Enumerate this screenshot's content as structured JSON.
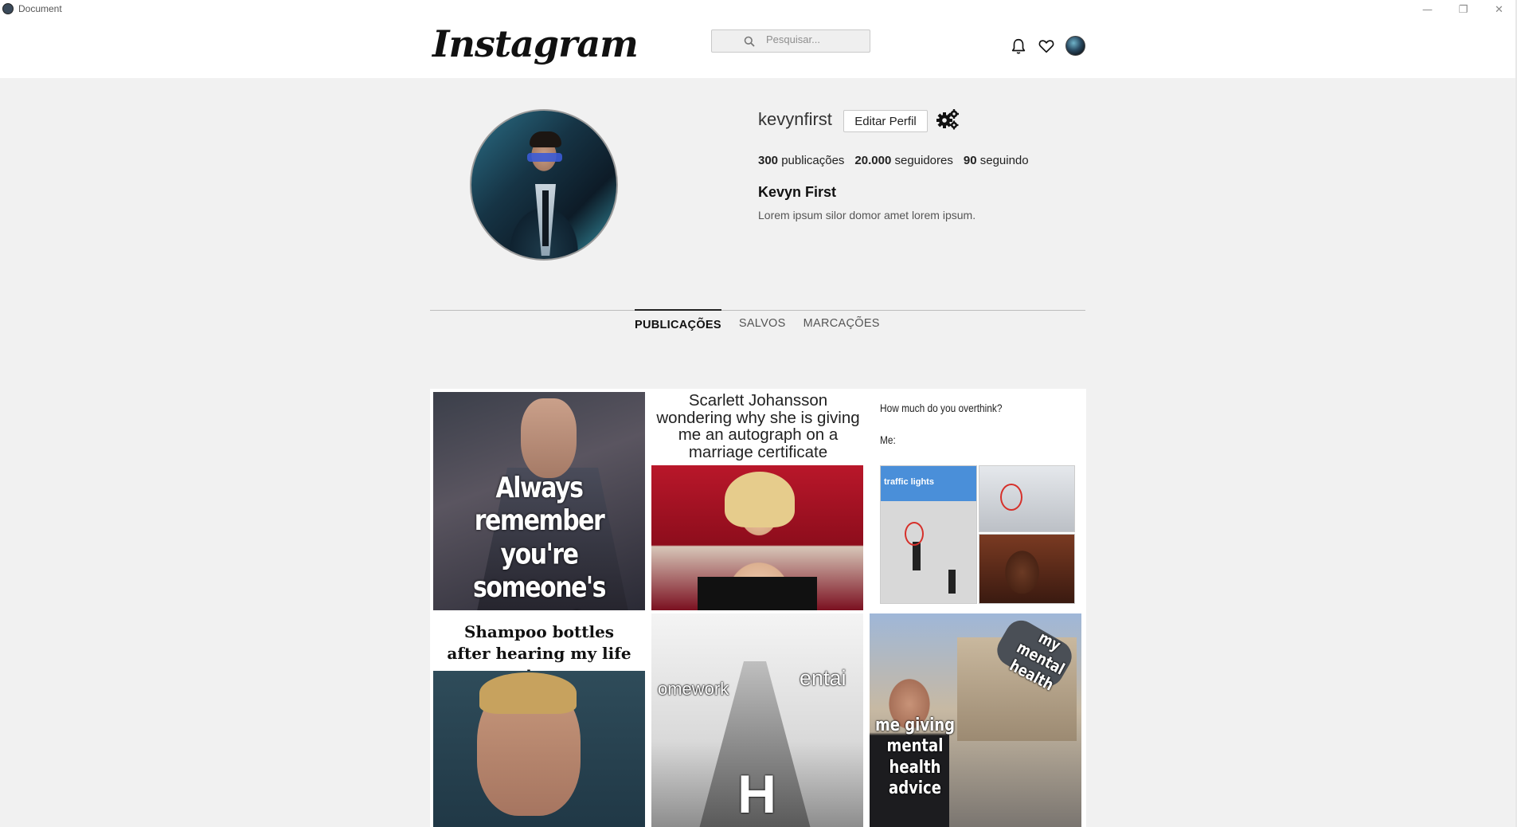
{
  "window": {
    "title": "Document",
    "minimize": "—",
    "restore": "❐",
    "close": "✕"
  },
  "nav": {
    "logo": "Instagram",
    "search_placeholder": "Pesquisar..."
  },
  "profile": {
    "username": "kevynfirst",
    "edit_label": "Editar Perfil",
    "stats": [
      {
        "count": "300",
        "label": "publicações"
      },
      {
        "count": "20.000",
        "label": "seguidores"
      },
      {
        "count": "90",
        "label": "seguindo"
      }
    ],
    "full_name": "Kevyn First",
    "bio": "Lorem ipsum silor domor amet lorem ipsum."
  },
  "tabs": [
    "PUBLICAÇÕES",
    "SALVOS",
    "MARCAÇÕES"
  ],
  "posts": {
    "p1": "Always remember you're someone's reason to smile Because you're a joke",
    "p2": "Scarlett Johansson wondering why she is giving me an autograph on a marriage certificate",
    "p3_question": "How much do you overthink?",
    "p3_me": "Me:",
    "p3_captcha": "traffic lights",
    "p4": "Shampoo bottles after hearing my life story",
    "p5_left": "omework",
    "p5_right": "entai",
    "p5_bottom": "H",
    "p6_top": "my mental health",
    "p6_bottom": "me giving mental health advice"
  }
}
